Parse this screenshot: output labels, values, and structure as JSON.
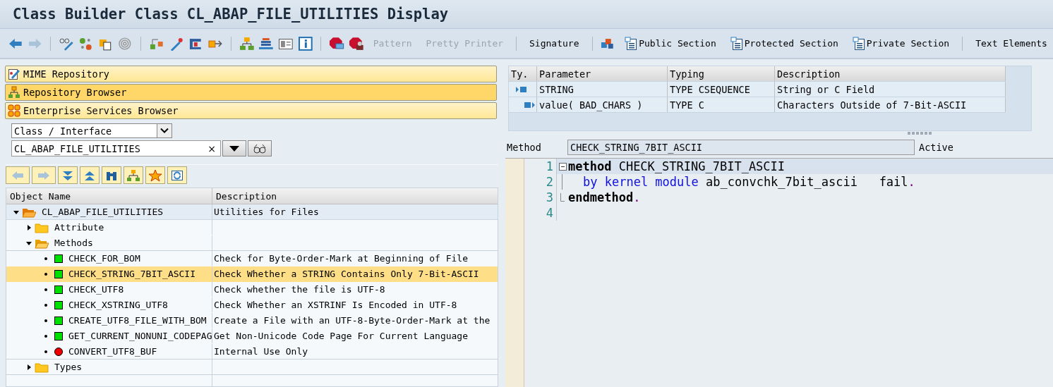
{
  "window": {
    "title": "Class Builder Class CL_ABAP_FILE_UTILITIES Display"
  },
  "toolbar": {
    "text_buttons": [
      {
        "label": "Pattern",
        "disabled": true
      },
      {
        "label": "Pretty Printer",
        "disabled": true
      },
      {
        "label": "Signature",
        "disabled": false
      },
      {
        "label": "Public Section",
        "disabled": false
      },
      {
        "label": "Protected Section",
        "disabled": false
      },
      {
        "label": "Private Section",
        "disabled": false
      },
      {
        "label": "Text Elements",
        "disabled": false
      }
    ]
  },
  "navigation": [
    {
      "label": "MIME Repository",
      "selected": false
    },
    {
      "label": "Repository Browser",
      "selected": true
    },
    {
      "label": "Enterprise Services Browser",
      "selected": false
    }
  ],
  "object_type": {
    "value": "Class / Interface"
  },
  "object_name": {
    "value": "CL_ABAP_FILE_UTILITIES",
    "clear": "×"
  },
  "tree": {
    "columns": [
      "Object Name",
      "Description"
    ],
    "items": [
      {
        "name": "CL_ABAP_FILE_UTILITIES",
        "description": "Utilities for Files",
        "kind": "class",
        "expanded": true,
        "selected": false,
        "children": [
          {
            "name": "Attribute",
            "kind": "folder",
            "expanded": false,
            "selected": false
          },
          {
            "name": "Methods",
            "kind": "folder",
            "expanded": true,
            "selected": false,
            "children": [
              {
                "name": "CHECK_FOR_BOM",
                "description": "Check for Byte-Order-Mark at Beginning of File",
                "kind": "method",
                "color": "#00e000",
                "selected": false
              },
              {
                "name": "CHECK_STRING_7BIT_ASCII",
                "description": "Check Whether a STRING Contains Only 7-Bit-ASCII",
                "kind": "method",
                "color": "#00e000",
                "selected": true
              },
              {
                "name": "CHECK_UTF8",
                "description": "Check whether the file is UTF-8",
                "kind": "method",
                "color": "#00e000",
                "selected": false
              },
              {
                "name": "CHECK_XSTRING_UTF8",
                "description": "Check Whether an XSTRINF Is Encoded in UTF-8",
                "kind": "method",
                "color": "#00e000",
                "selected": false
              },
              {
                "name": "CREATE_UTF8_FILE_WITH_BOM",
                "description": "Create a File with an UTF-8-Byte-Order-Mark at the",
                "kind": "method",
                "color": "#00e000",
                "selected": false
              },
              {
                "name": "GET_CURRENT_NONUNI_CODEPAG",
                "description": "Get Non-Unicode Code Page For Current Language",
                "kind": "method",
                "color": "#00e000",
                "selected": false
              },
              {
                "name": "CONVERT_UTF8_BUF",
                "description": "Internal Use Only",
                "kind": "method",
                "color": "#ee0000",
                "selected": false
              }
            ]
          },
          {
            "name": "Types",
            "kind": "folder",
            "expanded": false,
            "selected": false
          }
        ]
      }
    ]
  },
  "parameters": {
    "columns": [
      "Ty.",
      "Parameter",
      "Typing",
      "Description"
    ],
    "rows": [
      {
        "kind": "importing",
        "parameter": "STRING",
        "typing": "TYPE CSEQUENCE",
        "description": "String or C Field"
      },
      {
        "kind": "returning",
        "parameter": "value( BAD_CHARS )",
        "typing": "TYPE C",
        "description": "Characters Outside of 7-Bit-ASCII"
      }
    ]
  },
  "method": {
    "label": "Method",
    "value": "CHECK_STRING_7BIT_ASCII",
    "status": "Active"
  },
  "editor": {
    "lines": [
      {
        "number": "1",
        "kind": "start",
        "tokens": [
          {
            "kind": "keyword",
            "text": "method"
          },
          {
            "kind": "plain",
            "text": " CHECK_STRING_7BIT_ASCII"
          }
        ]
      },
      {
        "number": "2",
        "kind": "inner",
        "tokens": [
          {
            "kind": "blue",
            "text": "by kernel module"
          },
          {
            "kind": "plain",
            "text": " ab_convchk_7bit_ascii   fail"
          },
          {
            "kind": "punct",
            "text": "."
          }
        ]
      },
      {
        "number": "3",
        "kind": "end",
        "tokens": [
          {
            "kind": "keyword",
            "text": "endmethod"
          },
          {
            "kind": "punct",
            "text": "."
          }
        ]
      },
      {
        "number": "4",
        "kind": "plain"
      }
    ]
  }
}
